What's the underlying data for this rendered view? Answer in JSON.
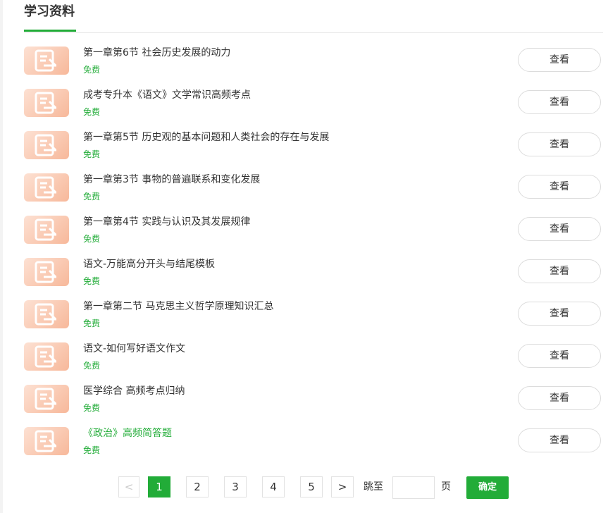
{
  "section": {
    "title": "学习资料"
  },
  "items": [
    {
      "title": "第一章第6节 社会历史发展的动力",
      "price": "免费",
      "action": "查看"
    },
    {
      "title": "成考专升本《语文》文学常识高频考点",
      "price": "免费",
      "action": "查看"
    },
    {
      "title": "第一章第5节 历史观的基本问题和人类社会的存在与发展",
      "price": "免费",
      "action": "查看"
    },
    {
      "title": "第一章第3节 事物的普遍联系和变化发展",
      "price": "免费",
      "action": "查看"
    },
    {
      "title": "第一章第4节 实践与认识及其发展规律",
      "price": "免费",
      "action": "查看"
    },
    {
      "title": "语文-万能高分开头与结尾模板",
      "price": "免费",
      "action": "查看"
    },
    {
      "title": "第一章第二节 马克思主义哲学原理知识汇总",
      "price": "免费",
      "action": "查看"
    },
    {
      "title": "语文-如何写好语文作文",
      "price": "免费",
      "action": "查看"
    },
    {
      "title": "医学综合 高频考点归纳",
      "price": "免费",
      "action": "查看"
    },
    {
      "title": "《政治》高频简答题",
      "price": "免费",
      "action": "查看",
      "highlight": true
    }
  ],
  "pagination": {
    "prev": "<",
    "pages": [
      "1",
      "2",
      "3",
      "4",
      "5"
    ],
    "current": "1",
    "next": ">",
    "jump_label": "跳至",
    "jump_value": "",
    "page_unit": "页",
    "confirm": "确定"
  },
  "colors": {
    "accent": "#22ac38",
    "thumb": "#f7b89a"
  },
  "icons": {
    "thumbnail": "document-list-icon"
  }
}
